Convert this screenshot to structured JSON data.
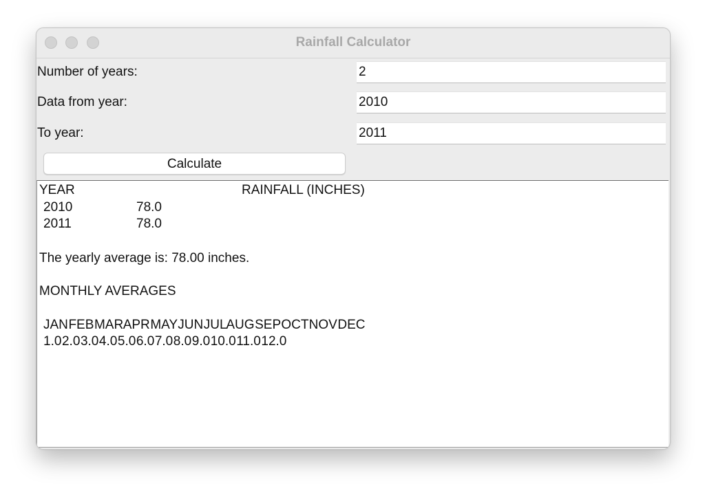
{
  "window": {
    "title": "Rainfall Calculator"
  },
  "form": {
    "years_label": "Number of years:",
    "years_value": "2",
    "from_label": "Data from year:",
    "from_value": "2010",
    "to_label": "To year:",
    "to_value": "2011",
    "calculate_label": "Calculate"
  },
  "output": {
    "header_year": "YEAR",
    "header_rainfall": "RAINFALL (INCHES)",
    "rows": [
      {
        "year": "2010",
        "rainfall": "78.0"
      },
      {
        "year": "2011",
        "rainfall": "78.0"
      }
    ],
    "yearly_average": "The yearly average is: 78.00 inches.",
    "monthly_heading": "MONTHLY AVERAGES",
    "months_line": "JAN  FEB  MAR  APR  MAY  JUN  JUL  AUG  SEP  OCT  NOV  DEC",
    "values_line": "1.0  2.0  3.0  4.0  5.0  6.0  7.0  8.0  9.0  10.0  11.0  12.0"
  }
}
